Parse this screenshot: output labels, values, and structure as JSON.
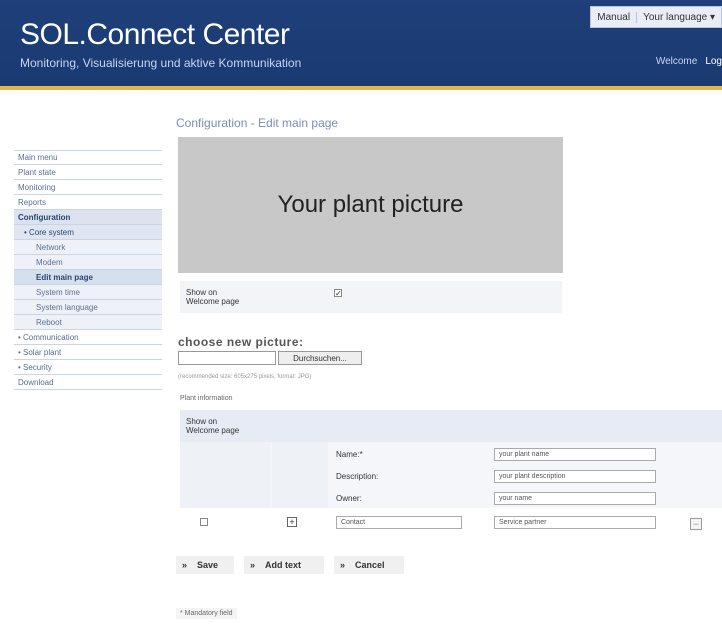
{
  "header": {
    "title": "SOL.Connect Center",
    "tagline": "Monitoring, Visualisierung und aktive Kommunikation",
    "top_menu": [
      "Manual",
      "Your language ▾"
    ],
    "welcome": [
      "Welcome",
      "Log"
    ]
  },
  "sidebar": {
    "items": [
      {
        "label": "Main menu"
      },
      {
        "label": "Plant state"
      },
      {
        "label": "Monitoring"
      },
      {
        "label": "Reports"
      },
      {
        "label": "Configuration"
      },
      {
        "label": "• Core system"
      },
      {
        "label": "Network"
      },
      {
        "label": "Modem"
      },
      {
        "label": "Edit main page"
      },
      {
        "label": "System time"
      },
      {
        "label": "System language"
      },
      {
        "label": "Reboot"
      },
      {
        "label": "• Communication"
      },
      {
        "label": "• Solar plant"
      },
      {
        "label": "• Security"
      },
      {
        "label": "Download"
      }
    ]
  },
  "main": {
    "title": "Configuration - Edit main page",
    "picture_text": "Your plant picture",
    "show_on_welcome": "Show on\nWelcome page",
    "show_checked": true,
    "choose_label": "choose new picture:",
    "browse_label": "Durchsuchen...",
    "hint": "(recommended size: 605x275 pixels, format: JPG)",
    "plant_info_label": "Plant information",
    "table_header_label": "Show on\nWelcome page",
    "fields": {
      "name_label": "Name:*",
      "name_value": "your plant name",
      "description_label": "Description:",
      "description_value": "your plant description",
      "owner_label": "Owner:",
      "owner_value": "your name",
      "contact_value": "Contact",
      "service_value": "Service partner"
    },
    "actions": {
      "save": "Save",
      "add_text": "Add text",
      "cancel": "Cancel",
      "arrow": "»"
    },
    "mandatory": "* Mandatory field"
  }
}
